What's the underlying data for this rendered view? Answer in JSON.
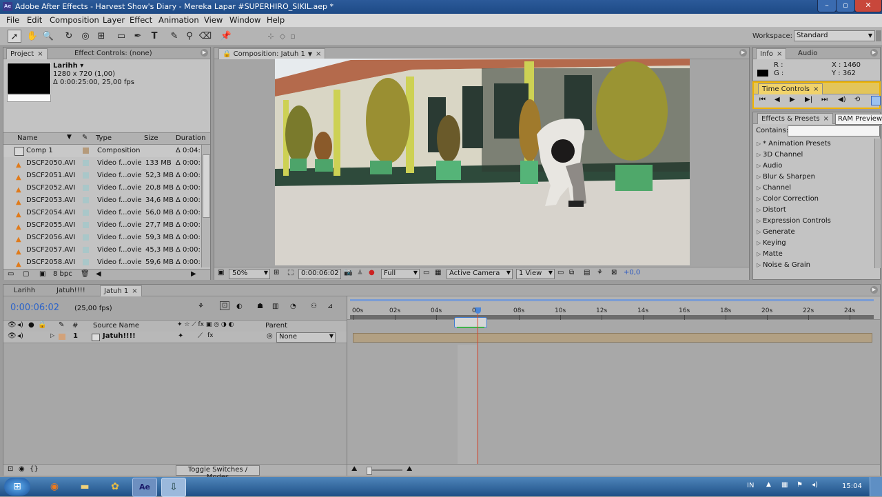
{
  "window": {
    "title": "Adobe After Effects - Harvest Show's Diary - Mereka Lapar #SUPERHIRO_SIKIL.aep *",
    "app_icon": "Ae",
    "buttons": [
      "–",
      "▫",
      "✕"
    ]
  },
  "menu": [
    "File",
    "Edit",
    "Composition",
    "Layer",
    "Effect",
    "Animation",
    "View",
    "Window",
    "Help"
  ],
  "workspace": {
    "label": "Workspace:",
    "value": "Standard"
  },
  "project": {
    "tabs": [
      "Project",
      "Effect Controls: (none)"
    ],
    "comp_name": "Larihh ▾",
    "comp_size": "1280 x 720 (1,00)",
    "comp_duration": "Δ 0:00:25:00, 25,00 fps",
    "columns": [
      "Name",
      "Type",
      "Size",
      "Duration"
    ],
    "items": [
      {
        "name": "Comp 1",
        "type": "Composition",
        "size": "",
        "duration": "Δ 0:04:"
      },
      {
        "name": "DSCF2050.AVI",
        "type": "Video f...ovie",
        "size": "133 MB",
        "duration": "Δ 0:00:"
      },
      {
        "name": "DSCF2051.AVI",
        "type": "Video f...ovie",
        "size": "52,3 MB",
        "duration": "Δ 0:00:"
      },
      {
        "name": "DSCF2052.AVI",
        "type": "Video f...ovie",
        "size": "20,8 MB",
        "duration": "Δ 0:00:"
      },
      {
        "name": "DSCF2053.AVI",
        "type": "Video f...ovie",
        "size": "34,6 MB",
        "duration": "Δ 0:00:"
      },
      {
        "name": "DSCF2054.AVI",
        "type": "Video f...ovie",
        "size": "56,0 MB",
        "duration": "Δ 0:00:"
      },
      {
        "name": "DSCF2055.AVI",
        "type": "Video f...ovie",
        "size": "27,7 MB",
        "duration": "Δ 0:00:"
      },
      {
        "name": "DSCF2056.AVI",
        "type": "Video f...ovie",
        "size": "59,3 MB",
        "duration": "Δ 0:00:"
      },
      {
        "name": "DSCF2057.AVI",
        "type": "Video f...ovie",
        "size": "45,3 MB",
        "duration": "Δ 0:00:"
      },
      {
        "name": "DSCF2058.AVI",
        "type": "Video f...ovie",
        "size": "59,6 MB",
        "duration": "Δ 0:00:"
      }
    ],
    "bpc": "8 bpc"
  },
  "composition": {
    "tab": "Composition: Jatuh 1",
    "zoom": "50%",
    "timecode": "0:00:06:02",
    "resolution": "Full",
    "camera": "Active Camera",
    "view": "1 View",
    "exposure": "+0,0"
  },
  "info": {
    "tabs": [
      "Info",
      "Audio"
    ],
    "r_label": "R :",
    "g_label": "G :",
    "x": "X : 1460",
    "y": "Y : 362"
  },
  "time_controls": {
    "tab": "Time Controls",
    "tooltip": "RAM Preview"
  },
  "effects": {
    "tab": "Effects & Presets",
    "contains_label": "Contains:",
    "items": [
      "* Animation Presets",
      "3D Channel",
      "Audio",
      "Blur & Sharpen",
      "Channel",
      "Color Correction",
      "Distort",
      "Expression Controls",
      "Generate",
      "Keying",
      "Matte",
      "Noise & Grain"
    ]
  },
  "timeline": {
    "tabs": [
      "Larihh",
      "Jatuh!!!!",
      "Jatuh 1"
    ],
    "timecode": "0:00:06:02",
    "fps": "(25,00 fps)",
    "columns": {
      "number": "#",
      "source": "Source Name",
      "parent": "Parent"
    },
    "layer": {
      "number": "1",
      "name": "Jatuh!!!!",
      "parent": "None"
    },
    "ruler": [
      "00s",
      "02s",
      "04s",
      "0",
      "08s",
      "10s",
      "12s",
      "14s",
      "16s",
      "18s",
      "20s",
      "22s",
      "24s"
    ],
    "toggle_label": "Toggle Switches / Modes"
  },
  "taskbar": {
    "start": "⊞",
    "items": [
      "firefox",
      "folder",
      "paint",
      "after-effects",
      "pinned"
    ],
    "lang": "IN",
    "time": "15:04"
  }
}
